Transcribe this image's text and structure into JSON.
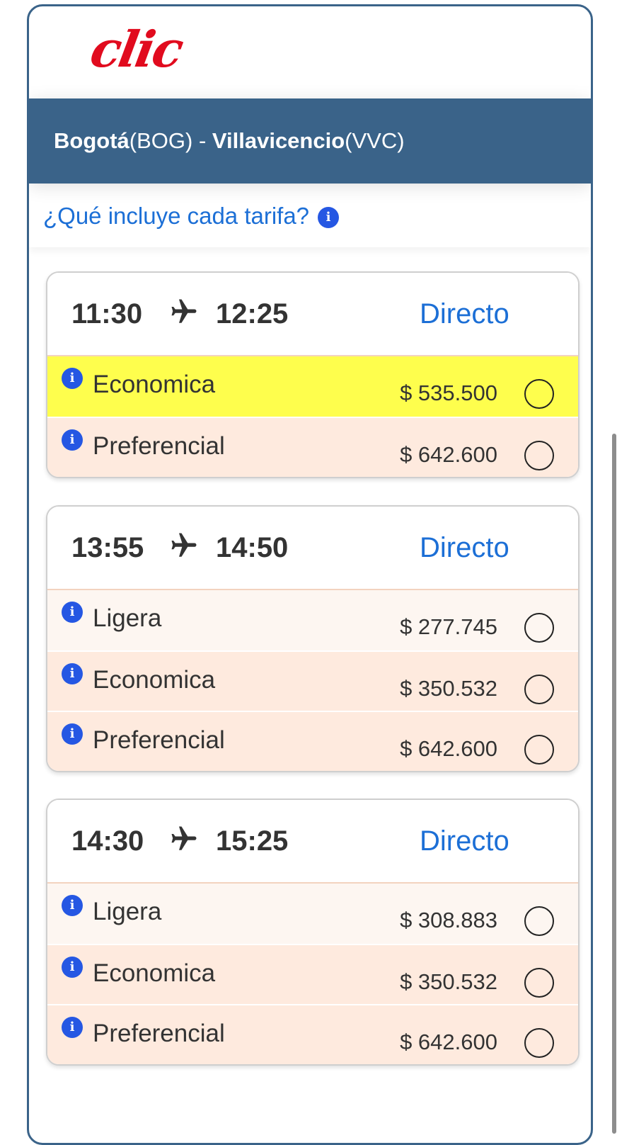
{
  "logo": "clic",
  "route": {
    "origin_city": "Bogotá",
    "origin_code": "(BOG)",
    "separator": " - ",
    "dest_city": "Villavicencio",
    "dest_code": "(VVC)"
  },
  "fare_info_link": "¿Qué incluye cada tarifa?",
  "flights": [
    {
      "departure": "11:30",
      "arrival": "12:25",
      "type": "Directo",
      "fares": [
        {
          "name": "Economica",
          "price": "$ 535.500",
          "selected": true
        },
        {
          "name": "Preferencial",
          "price": "$ 642.600",
          "selected": false
        }
      ]
    },
    {
      "departure": "13:55",
      "arrival": "14:50",
      "type": "Directo",
      "fares": [
        {
          "name": "Ligera",
          "price": "$ 277.745",
          "selected": false
        },
        {
          "name": "Economica",
          "price": "$ 350.532",
          "selected": false
        },
        {
          "name": "Preferencial",
          "price": "$ 642.600",
          "selected": false
        }
      ]
    },
    {
      "departure": "14:30",
      "arrival": "15:25",
      "type": "Directo",
      "fares": [
        {
          "name": "Ligera",
          "price": "$ 308.883",
          "selected": false
        },
        {
          "name": "Economica",
          "price": "$ 350.532",
          "selected": false
        },
        {
          "name": "Preferencial",
          "price": "$ 642.600",
          "selected": false
        }
      ]
    }
  ],
  "colors": {
    "brand_red": "#e10b1e",
    "header_blue": "#3a6389",
    "link_blue": "#1c6fd6",
    "info_icon_blue": "#2557e3",
    "selected_row": "#fefe4d",
    "fare_row_light": "#fdf6f1",
    "fare_row_peach": "#feeade"
  },
  "icons": {
    "info": "info-icon",
    "plane": "airplane-icon",
    "radio": "radio-button"
  }
}
